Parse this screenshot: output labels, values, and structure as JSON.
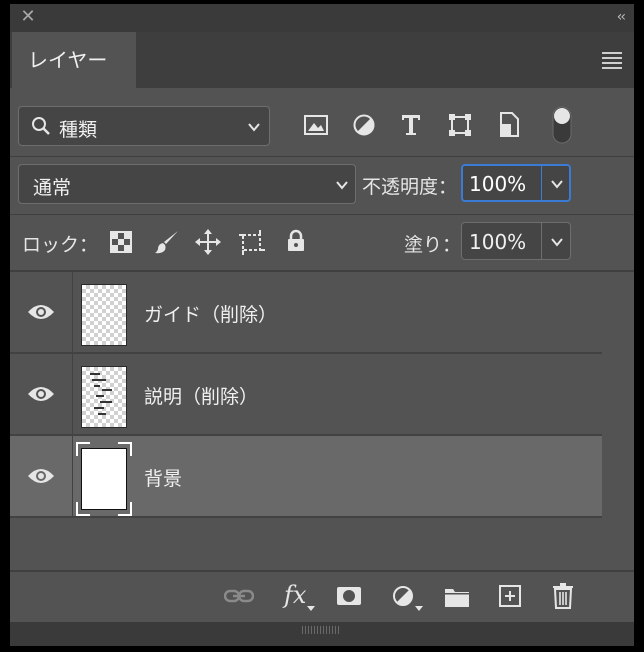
{
  "panel": {
    "tab_label": "レイヤー"
  },
  "filter": {
    "label": "種類",
    "icons": [
      "image-filter-icon",
      "adjustment-filter-icon",
      "type-filter-icon",
      "shape-filter-icon",
      "smart-object-filter-icon"
    ],
    "toggle": "filter-toggle"
  },
  "blend": {
    "mode": "通常",
    "opacity_label": "不透明度：",
    "opacity_value": "100%"
  },
  "lock": {
    "label": "ロック：",
    "icons": [
      "lock-transparent-pixels-icon",
      "lock-image-pixels-icon",
      "lock-position-icon",
      "lock-artboard-icon",
      "lock-all-icon"
    ],
    "fill_label": "塗り：",
    "fill_value": "100%"
  },
  "layers": [
    {
      "name": "ガイド（削除）",
      "thumb": "transparent",
      "visible": true,
      "selected": false
    },
    {
      "name": "説明（削除）",
      "thumb": "transparent-text",
      "visible": true,
      "selected": false
    },
    {
      "name": "背景",
      "thumb": "white",
      "visible": true,
      "selected": true
    }
  ],
  "bottom_bar": {
    "icons": [
      "link-layers-icon",
      "fx-icon",
      "add-mask-icon",
      "new-adjustment-icon",
      "new-group-folder-icon",
      "new-layer-icon",
      "trash-icon"
    ],
    "fx_text": "fx"
  },
  "colors": {
    "panel_bg": "#535353",
    "selected_row": "#696969",
    "focus_blue": "#3a7bd5"
  }
}
